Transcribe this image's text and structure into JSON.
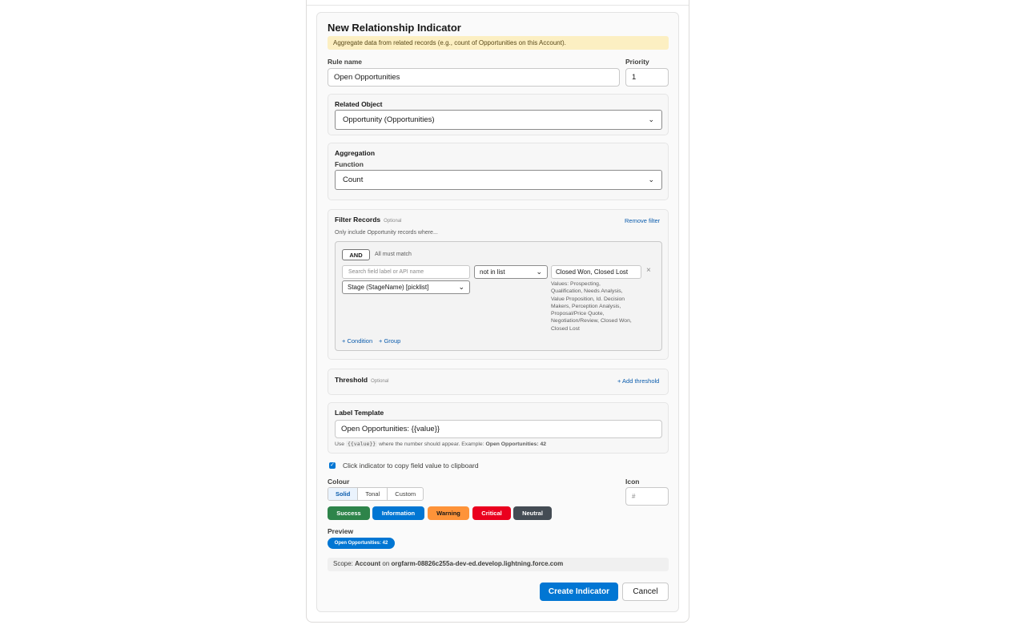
{
  "form": {
    "title": "New Relationship Indicator",
    "banner": "Aggregate data from related records (e.g., count of Opportunities on this Account).",
    "rule_name_label": "Rule name",
    "rule_name_value": "Open Opportunities",
    "priority_label": "Priority",
    "priority_value": "1"
  },
  "related_object": {
    "title": "Related Object",
    "selected": "Opportunity (Opportunities)"
  },
  "aggregation": {
    "title": "Aggregation",
    "function_label": "Function",
    "function_selected": "Count"
  },
  "filter": {
    "title": "Filter Records",
    "optional": "Optional",
    "remove_link": "Remove filter",
    "description": "Only include Opportunity records where...",
    "logic": "AND",
    "logic_hint": "All must match",
    "field_search_placeholder": "Search field label or API name",
    "field_selected": "Stage (StageName) [picklist]",
    "operator_selected": "not in list",
    "value": "Closed Won, Closed Lost",
    "remove_icon": "×",
    "values_hint": [
      "Values: Prospecting,",
      "Qualification, Needs Analysis,",
      "Value Proposition, Id. Decision",
      "Makers, Perception Analysis,",
      "Proposal/Price Quote,",
      "Negotiation/Review, Closed Won,",
      "Closed Lost"
    ],
    "add_condition": "+ Condition",
    "add_group": "+ Group"
  },
  "threshold": {
    "title": "Threshold",
    "optional": "Optional",
    "add_link": "+ Add threshold"
  },
  "label_template": {
    "title": "Label Template",
    "value": "Open Opportunities: {{value}}",
    "help_use": "Use",
    "help_code": "{{value}}",
    "help_rest": "where the number should appear. Example:",
    "help_example": "Open Opportunities: 42"
  },
  "copy_option": {
    "checked": true,
    "label": "Click indicator to copy field value to clipboard"
  },
  "colour": {
    "label": "Colour",
    "modes": [
      "Solid",
      "Tonal",
      "Custom"
    ],
    "active_mode": "Solid",
    "swatches": [
      {
        "label": "Success",
        "color": "#2e844a"
      },
      {
        "label": "Information",
        "color": "#0176d3"
      },
      {
        "label": "Warning",
        "color": "#fe9339"
      },
      {
        "label": "Critical",
        "color": "#ea001e"
      },
      {
        "label": "Neutral",
        "color": "#444c54"
      }
    ]
  },
  "icon": {
    "label": "Icon",
    "placeholder": "#"
  },
  "preview": {
    "label": "Preview",
    "pill": "Open Opportunities: 42"
  },
  "scope": {
    "prefix": "Scope:",
    "object": "Account",
    "on": "on",
    "org": "orgfarm-08826c255a-dev-ed.develop.lightning.force.com"
  },
  "actions": {
    "create": "Create Indicator",
    "cancel": "Cancel"
  }
}
